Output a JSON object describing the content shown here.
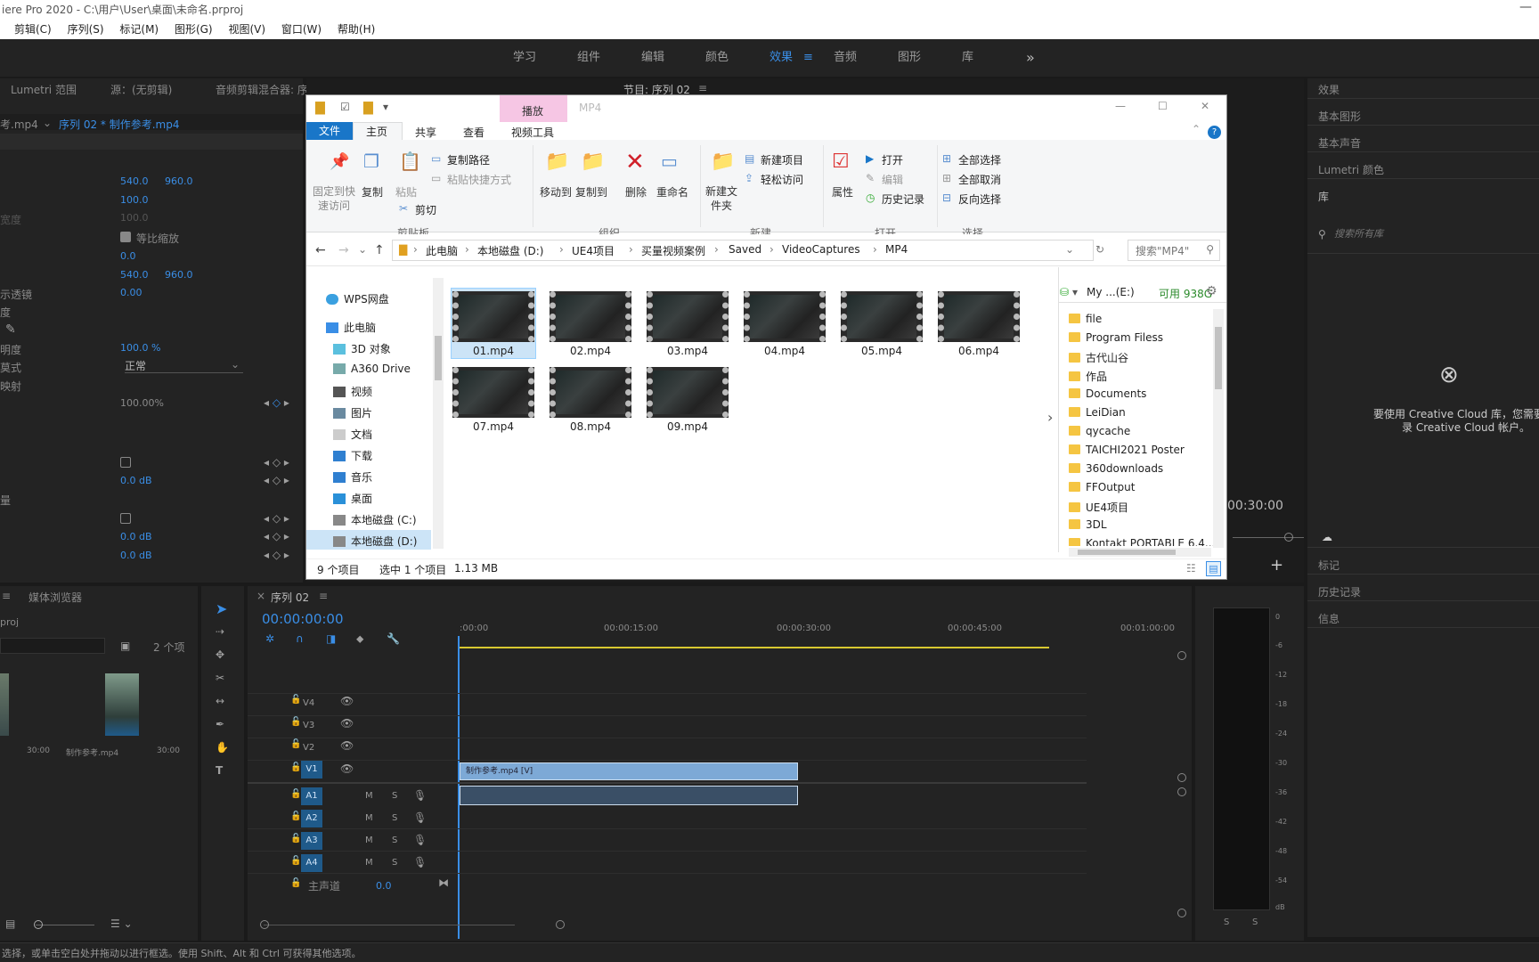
{
  "title_bar": {
    "text": "iere Pro 2020 - C:\\用户\\User\\桌面\\未命名.prproj",
    "controls": "—"
  },
  "menu": [
    "",
    "剪辑(C)",
    "序列(S)",
    "标记(M)",
    "图形(G)",
    "视图(V)",
    "窗口(W)",
    "帮助(H)"
  ],
  "workspaces": [
    "学习",
    "组件",
    "编辑",
    "颜色",
    "效果",
    "音频",
    "图形",
    "库"
  ],
  "workspace_active": "效果",
  "workspace_more": "»",
  "left_panel": {
    "tabs": [
      "Lumetri 范围",
      "源：(无剪辑)",
      "音频剪辑混合器: 序列 02"
    ],
    "clip_left": "考.mp4",
    "clip_right": "序列 02 * 制作参考.mp4",
    "rows": [
      {
        "label": "",
        "v1": "540.0",
        "v2": "960.0"
      },
      {
        "label": "",
        "v1": "100.0",
        "v2": ""
      },
      {
        "label": "宽度",
        "v1": "100.0",
        "v2": ""
      },
      {
        "label": "",
        "v1": "",
        "v2": ""
      },
      {
        "label": "",
        "v1": "0.0",
        "v2": ""
      },
      {
        "label": "",
        "v1": "540.0",
        "v2": "960.0"
      },
      {
        "label": "示透镜",
        "v1": "0.00",
        "v2": ""
      },
      {
        "label": "度",
        "v1": "",
        "v2": ""
      },
      {
        "label": "",
        "v1": "",
        "v2": ""
      },
      {
        "label": "明度",
        "v1": "100.0 %",
        "v2": ""
      },
      {
        "label": "莫式",
        "v1": "",
        "v2": ""
      },
      {
        "label": "映射",
        "v1": "",
        "v2": ""
      }
    ],
    "uniform_scale": "等比缩放",
    "blend_mode": "正常",
    "time_remap": "100.00%",
    "audio": [
      {
        "val": "0.0 dB"
      },
      {
        "val": "0.0 dB"
      },
      {
        "val": "0.0 dB"
      }
    ],
    "audio_label": "量"
  },
  "program_monitor": {
    "title": "节目: 序列 02",
    "timecode": "00:30:00"
  },
  "right_panel": {
    "items": [
      "效果",
      "基本图形",
      "基本声音",
      "Lumetri 颜色",
      "库"
    ],
    "search_placeholder": "搜索所有库",
    "cc_message_1": "要使用 Creative Cloud 库，您需要登",
    "cc_message_2": "录 Creative Cloud 帐户。",
    "lower_items": [
      "标记",
      "历史记录",
      "信息"
    ]
  },
  "explorer": {
    "qat_title": "MP4",
    "context_tab": "播放",
    "tabs": [
      "文件",
      "主页",
      "共享",
      "查看",
      "视频工具"
    ],
    "active_tab": "主页",
    "ribbon": {
      "clipboard": {
        "pin": "固定到快速访问",
        "copy": "复制",
        "paste": "粘贴",
        "copy_path": "复制路径",
        "paste_shortcut": "粘贴快捷方式",
        "cut": "剪切",
        "group": "剪贴板"
      },
      "organize": {
        "move": "移动到",
        "copyto": "复制到",
        "delete": "删除",
        "rename": "重命名",
        "group": "组织"
      },
      "new": {
        "new_folder": "新建文件夹",
        "new_item": "新建项目",
        "easy_access": "轻松访问",
        "group": "新建"
      },
      "open": {
        "props": "属性",
        "open": "打开",
        "edit": "编辑",
        "history": "历史记录",
        "group": "打开"
      },
      "select": {
        "all": "全部选择",
        "none": "全部取消",
        "invert": "反向选择",
        "group": "选择"
      }
    },
    "address": [
      "此电脑",
      "本地磁盘 (D:)",
      "UE4项目",
      "买量视频案例",
      "Saved",
      "VideoCaptures",
      "MP4"
    ],
    "search_placeholder": "搜索\"MP4\"",
    "nav": [
      "WPS网盘",
      "此电脑",
      "3D 对象",
      "A360 Drive",
      "视频",
      "图片",
      "文档",
      "下载",
      "音乐",
      "桌面",
      "本地磁盘 (C:)",
      "本地磁盘 (D:)"
    ],
    "files": [
      "01.mp4",
      "02.mp4",
      "03.mp4",
      "04.mp4",
      "05.mp4",
      "06.mp4",
      "07.mp4",
      "08.mp4",
      "09.mp4"
    ],
    "selected_file": "01.mp4",
    "status_count": "9 个项目",
    "status_selected": "选中 1 个项目",
    "status_size": "1.13 MB",
    "drive_label": "My ...(E:)",
    "drive_free": "可用 938G",
    "right_folders": [
      "file",
      "Program Filess",
      "古代山谷",
      "作品",
      "Documents",
      "LeiDian",
      "qycache",
      "TAICHI2021 Poster",
      "360downloads",
      "FFOutput",
      "UE4项目",
      "3DL",
      "Kontakt PORTABLE 6.4..."
    ]
  },
  "project_panel": {
    "tab": "媒体浏览器",
    "proj_label": "proj",
    "count": "2 个项",
    "items": [
      {
        "name": "",
        "dur": "30:00"
      },
      {
        "name": "制作参考.mp4",
        "dur": "30:00"
      }
    ]
  },
  "timeline": {
    "tab": "序列 02",
    "timecode": "00:00:00:00",
    "ruler": [
      ":00:00",
      "00:00:15:00",
      "00:00:30:00",
      "00:00:45:00",
      "00:01:00:00"
    ],
    "video_tracks": [
      "V4",
      "V3",
      "V2",
      "V1"
    ],
    "audio_tracks": [
      "A1",
      "A2",
      "A3",
      "A4"
    ],
    "master": "主声道",
    "master_val": "0.0",
    "clip_label": "制作参考.mp4 [V]",
    "track_m": "M",
    "track_s": "S"
  },
  "meter": {
    "scale": [
      "0",
      "-6",
      "-12",
      "-18",
      "-24",
      "-30",
      "-36",
      "-42",
      "-48",
      "-54",
      "dB"
    ],
    "solo": [
      "S",
      "S"
    ]
  },
  "status_bar": "选择，或单击空白处并拖动以进行框选。使用 Shift、Alt 和 Ctrl 可获得其他选项。"
}
